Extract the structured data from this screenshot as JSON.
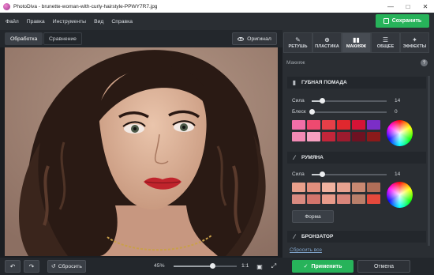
{
  "window": {
    "app_name": "PhotoDiva",
    "file_title": "PhotoDiva - brunette-woman-with-curly-hairstyle-PPWY7R7.jpg"
  },
  "menu": [
    "Файл",
    "Правка",
    "Инструменты",
    "Вид",
    "Справка"
  ],
  "toolbar": {
    "save_label": "Сохранить"
  },
  "left": {
    "tabs": [
      {
        "label": "Обработка",
        "active": true
      },
      {
        "label": "Сравнение",
        "active": false
      }
    ],
    "original_label": "Оригинал"
  },
  "right": {
    "tabs": [
      {
        "label": "РЕТУШЬ",
        "icon": "brush-icon"
      },
      {
        "label": "ПЛАСТИКА",
        "icon": "crosshair-icon"
      },
      {
        "label": "МАКИЯЖ",
        "icon": "lipstick-icon",
        "active": true
      },
      {
        "label": "ОБЩЕЕ",
        "icon": "sliders-icon"
      },
      {
        "label": "ЭФФЕКТЫ",
        "icon": "effects-icon"
      }
    ],
    "header": "Макияж",
    "help": "?",
    "lipstick": {
      "title": "ГУБНАЯ ПОМАДА",
      "strength_label": "Сила",
      "strength_value": "14",
      "strength_level": 0.14,
      "gloss_label": "Блеск",
      "gloss_value": "0",
      "gloss_level": 0.0,
      "colors": [
        "#f06fa8",
        "#ee4a70",
        "#e63f48",
        "#e0282e",
        "#d41336",
        "#7b2ec7",
        "#f28ab4",
        "#f6a0c0",
        "#c2263a",
        "#9c1b2e",
        "#6e1222",
        "#8b1a1a"
      ]
    },
    "blush": {
      "title": "РУМЯНА",
      "strength_label": "Сила",
      "strength_value": "14",
      "strength_level": 0.14,
      "colors": [
        "#e9a08c",
        "#e28f7d",
        "#f0b2a0",
        "#e7a290",
        "#c98972",
        "#b06e58",
        "#d98a80",
        "#d3756c",
        "#e79a8a",
        "#d9857a",
        "#b97f6a",
        "#e5493c"
      ],
      "shape_label": "Форма"
    },
    "bronzer": {
      "title": "БРОНЗАТОР"
    },
    "reset_all": "Сбросить все"
  },
  "bottom": {
    "reset_label": "Сбросить",
    "zoom": "45%",
    "zoom_level": 0.62,
    "ratio": "1:1",
    "apply_label": "Применить",
    "cancel_label": "Отмена"
  }
}
